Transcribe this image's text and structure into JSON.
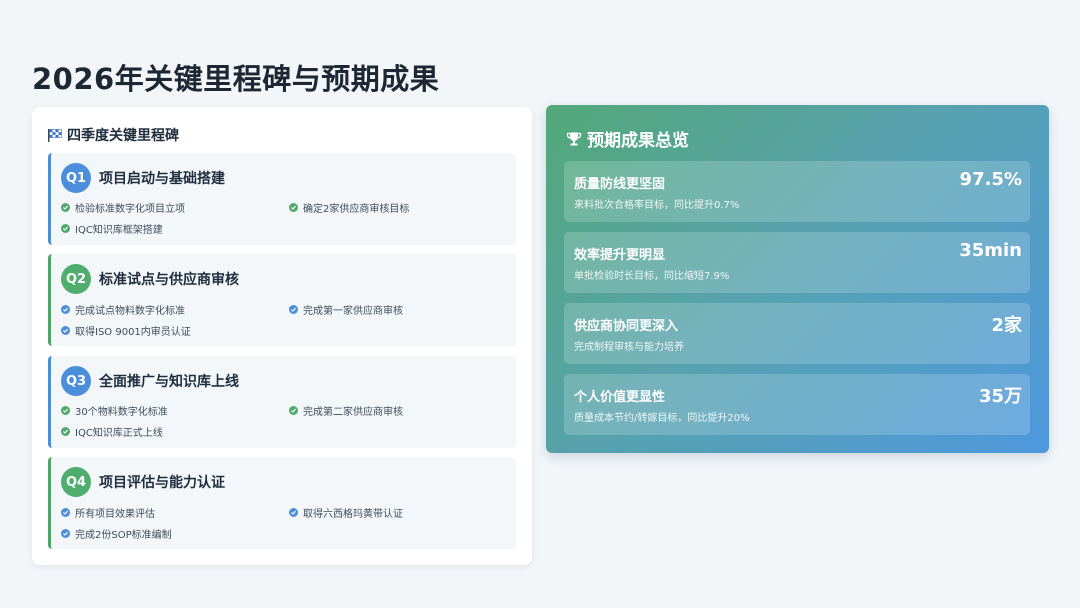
{
  "page": {
    "title": "2026年关键里程碑与预期成果"
  },
  "milestones": {
    "heading": "四季度关键里程碑",
    "quarters": [
      {
        "badge": "Q1",
        "title": "项目启动与基础搭建",
        "items": [
          "检验标准数字化项目立项",
          "确定2家供应商审核目标",
          "IQC知识库框架搭建"
        ]
      },
      {
        "badge": "Q2",
        "title": "标准试点与供应商审核",
        "items": [
          "完成试点物料数字化标准",
          "完成第一家供应商审核",
          "取得ISO 9001内审员认证"
        ]
      },
      {
        "badge": "Q3",
        "title": "全面推广与知识库上线",
        "items": [
          "30个物料数字化标准",
          "完成第二家供应商审核",
          "IQC知识库正式上线"
        ]
      },
      {
        "badge": "Q4",
        "title": "项目评估与能力认证",
        "items": [
          "所有项目效果评估",
          "取得六西格玛黄带认证",
          "完成2份SOP标准编制"
        ]
      }
    ]
  },
  "results": {
    "heading": "预期成果总览",
    "items": [
      {
        "title": "质量防线更坚固",
        "subtitle": "来料批次合格率目标，同比提升0.7%",
        "value": "97.5%"
      },
      {
        "title": "效率提升更明显",
        "subtitle": "单批检验时长目标，同比缩短7.9%",
        "value": "35min"
      },
      {
        "title": "供应商协同更深入",
        "subtitle": "完成制程审核与能力培养",
        "value": "2家"
      },
      {
        "title": "个人价值更显性",
        "subtitle": "质量成本节约/转嫁目标，同比提升20%",
        "value": "35万"
      }
    ]
  },
  "colors": {
    "accent_blue": "#4b8fdb",
    "accent_green": "#4fae6d",
    "gradient_start": "#52a878",
    "gradient_end": "#4e98de"
  },
  "icons": {
    "milestone_heading": "checkered-flag-icon",
    "results_heading": "trophy-icon",
    "item": "check-circle-icon"
  }
}
